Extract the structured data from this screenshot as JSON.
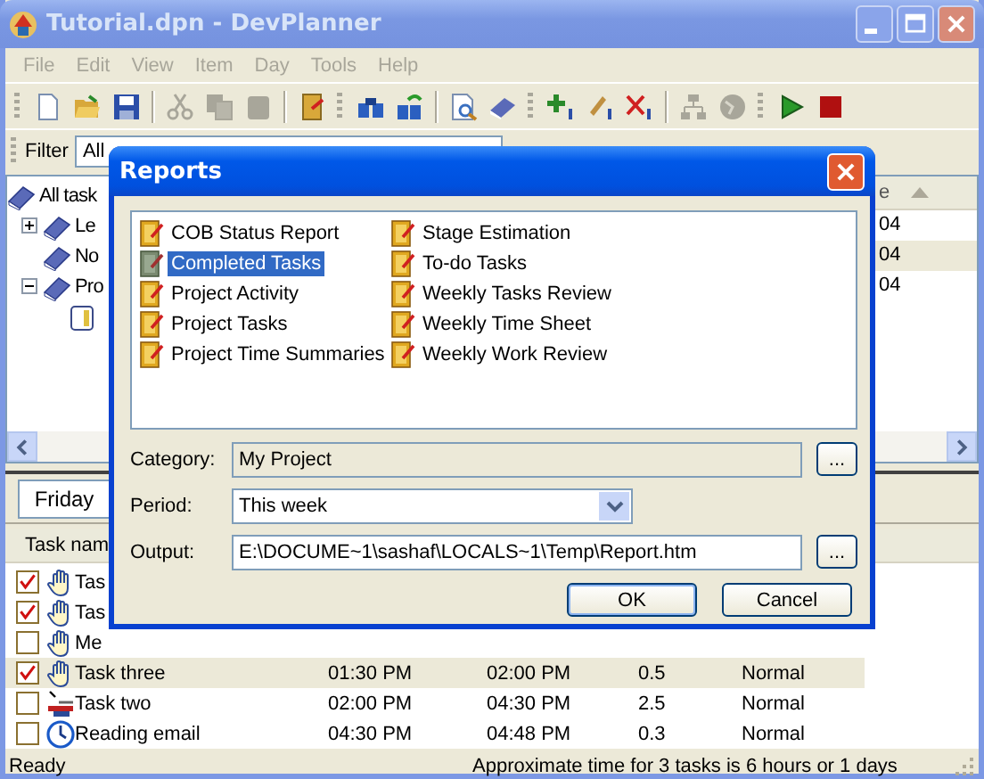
{
  "window": {
    "title": "Tutorial.dpn - DevPlanner"
  },
  "menu": [
    "File",
    "Edit",
    "View",
    "Item",
    "Day",
    "Tools",
    "Help"
  ],
  "filter": {
    "label": "Filter",
    "value": "All"
  },
  "tree": [
    {
      "label": "All task",
      "children": [
        {
          "label": "Le",
          "expanded": false
        },
        {
          "label": "No"
        },
        {
          "label": "Pro",
          "expanded": true,
          "children": [
            {
              "kind": "notebook"
            }
          ]
        }
      ]
    }
  ],
  "side_list": {
    "column": "e",
    "rows": [
      {
        "text": "04",
        "selected": false
      },
      {
        "text": "04",
        "selected": true
      },
      {
        "text": "04",
        "selected": false
      }
    ]
  },
  "day": {
    "label": "Friday"
  },
  "tasks": {
    "column": "Task nam",
    "rows": [
      {
        "kind": "hand",
        "checked": true,
        "name": "Tas",
        "selected": false
      },
      {
        "kind": "hand",
        "checked": true,
        "name": "Tas",
        "selected": false
      },
      {
        "kind": "hand",
        "checked": false,
        "name": "Me",
        "selected": false
      },
      {
        "kind": "hand",
        "checked": true,
        "name": "Task three",
        "start": "01:30 PM",
        "end": "02:00 PM",
        "hours": "0.5",
        "priority": "Normal",
        "selected": true
      },
      {
        "kind": "tools",
        "checked": false,
        "name": "Task two",
        "start": "02:00 PM",
        "end": "04:30 PM",
        "hours": "2.5",
        "priority": "Normal",
        "selected": false
      },
      {
        "kind": "clock",
        "checked": false,
        "name": "Reading email",
        "start": "04:30 PM",
        "end": "04:48 PM",
        "hours": "0.3",
        "priority": "Normal",
        "selected": false
      }
    ]
  },
  "status_bar": {
    "left": "Ready",
    "right": "Approximate time for 3 tasks is 6 hours or 1 days"
  },
  "dialog": {
    "title": "Reports",
    "reports": [
      {
        "label": "COB Status Report",
        "selected": false
      },
      {
        "label": "Completed Tasks",
        "selected": true
      },
      {
        "label": "Project Activity",
        "selected": false
      },
      {
        "label": "Project Tasks",
        "selected": false
      },
      {
        "label": "Project Time Summaries",
        "selected": false
      },
      {
        "label": "Stage Estimation",
        "selected": false
      },
      {
        "label": "To-do Tasks",
        "selected": false
      },
      {
        "label": "Weekly Tasks Review",
        "selected": false
      },
      {
        "label": "Weekly Time Sheet",
        "selected": false
      },
      {
        "label": "Weekly Work Review",
        "selected": false
      }
    ],
    "category": {
      "label": "Category:",
      "value": "My Project",
      "browse": "..."
    },
    "period": {
      "label": "Period:",
      "value": "This week"
    },
    "output": {
      "label": "Output:",
      "value": "E:\\DOCUME~1\\sashaf\\LOCALS~1\\Temp\\Report.htm",
      "browse": "..."
    },
    "buttons": [
      "OK",
      "Cancel"
    ]
  }
}
